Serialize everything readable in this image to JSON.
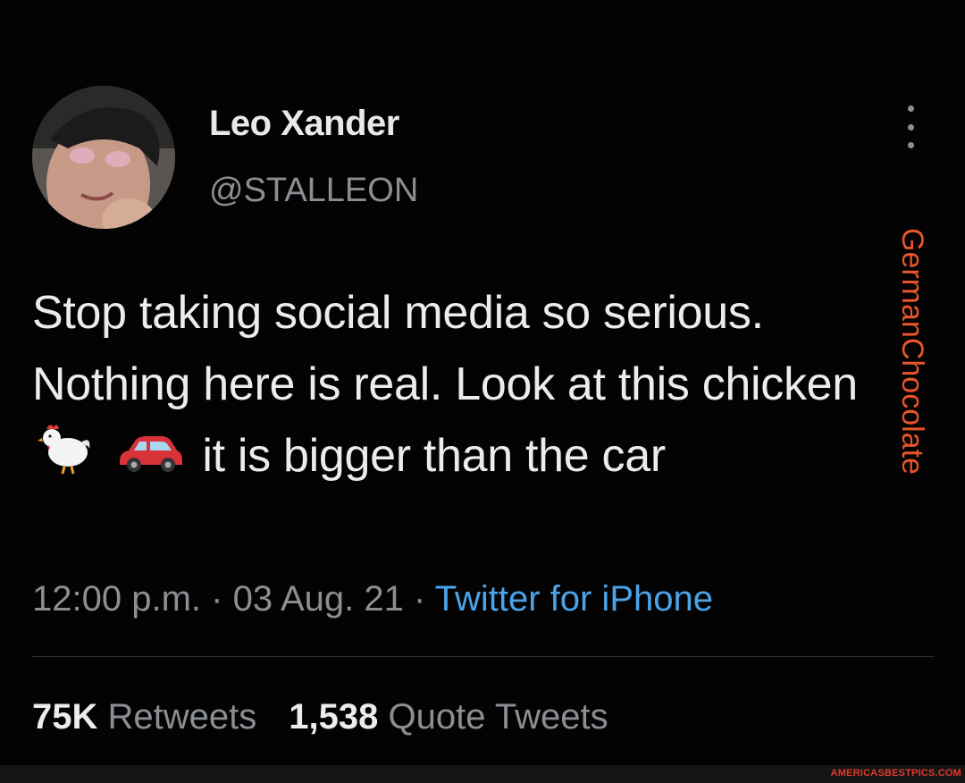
{
  "author": {
    "name": "Leo Xander",
    "handle": "@STALLEON"
  },
  "tweet": {
    "text_part1": "Stop taking social media so serious. Nothing here is real. Look at this chicken",
    "emoji_1": "chicken-emoji",
    "emoji_2": "car-emoji",
    "text_part2": "it is bigger than the car",
    "time": "12:00 p.m.",
    "date": "03 Aug. 21",
    "separator": "·",
    "source": "Twitter for iPhone"
  },
  "stats": {
    "retweets_count": "75K",
    "retweets_label": "Retweets",
    "quotes_count": "1,538",
    "quotes_label": "Quote Tweets"
  },
  "watermark": "GermanChocolate",
  "footer": {
    "site": "AMERICASBESTPICS.COM"
  },
  "colors": {
    "background": "#030303",
    "link": "#4ba3e8",
    "muted": "#8b8f94",
    "watermark": "#e8552a"
  }
}
